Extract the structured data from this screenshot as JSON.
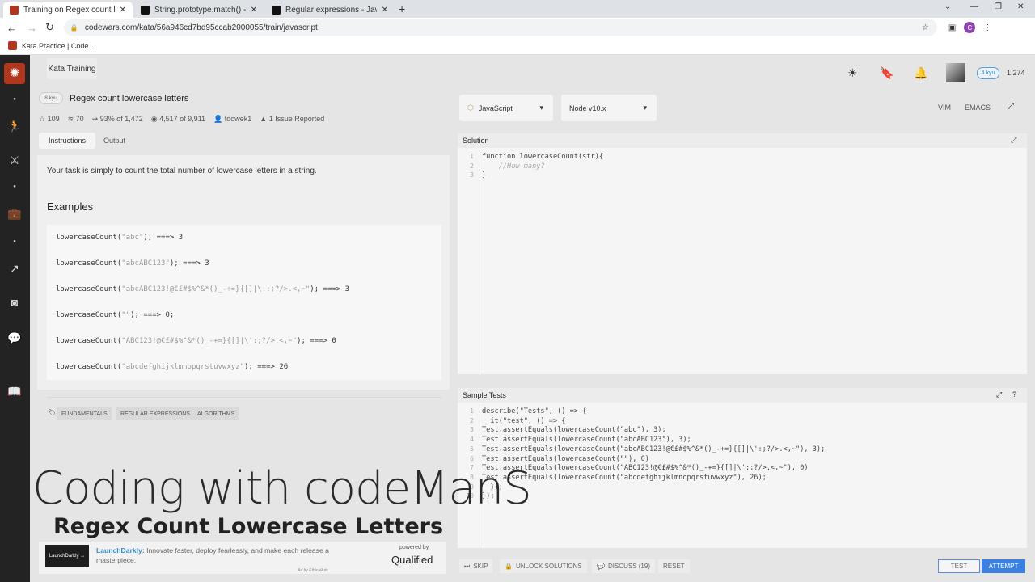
{
  "browser": {
    "tabs": [
      {
        "title": "Training on Regex count lowercase",
        "active": true
      },
      {
        "title": "String.prototype.match() - JavaSc",
        "active": false
      },
      {
        "title": "Regular expressions - JavaScript |",
        "active": false
      }
    ],
    "url": "codewars.com/kata/56a946cd7bd95ccab2000055/train/javascript",
    "bookmark": "Kata Practice | Code...",
    "profile_initial": "C"
  },
  "header": {
    "section": "Kata Training",
    "rank": "4 kyu",
    "honor": "1,274"
  },
  "kata": {
    "kyu": "8 kyu",
    "title": "Regex count lowercase letters",
    "stars": "109",
    "collections": "70",
    "satisfaction": "93% of 1,472",
    "completed": "4,517",
    "completed_of": "of 9,911",
    "author": "tdowek1",
    "issues": "1 Issue Reported"
  },
  "tabs": {
    "instructions": "Instructions",
    "output": "Output"
  },
  "description": "Your task is simply to count the total number of lowercase letters in a string.",
  "examples_heading": "Examples",
  "examples": [
    {
      "fn": "lowercaseCount(",
      "arg": "\"abc\"",
      "rest": "); ===> 3"
    },
    {
      "fn": "lowercaseCount(",
      "arg": "\"abcABC123\"",
      "rest": "); ===> 3"
    },
    {
      "fn": "lowercaseCount(",
      "arg": "\"abcABC123!@€£#$%^&*()_-+=}{[]|\\':;?/>.<,~\"",
      "rest": "); ===> 3"
    },
    {
      "fn": "lowercaseCount(",
      "arg": "\"\"",
      "rest": "); ===> 0;"
    },
    {
      "fn": "lowercaseCount(",
      "arg": "\"ABC123!@€£#$%^&*()_-+=}{[]|\\':;?/>.<,~\"",
      "rest": "); ===> 0"
    },
    {
      "fn": "lowercaseCount(",
      "arg": "\"abcdefghijklmnopqrstuvwxyz\"",
      "rest": "); ===> 26"
    }
  ],
  "tags": [
    "FUNDAMENTALS",
    "REGULAR EXPRESSIONS",
    "ALGORITHMS"
  ],
  "overlay": {
    "title": "Coding with codeManS",
    "subtitle": "Regex Count Lowercase Letters"
  },
  "ad": {
    "logo": "LaunchDarkly →",
    "brand": "LaunchDarkly:",
    "text": "Innovate faster, deploy fearlessly, and make each release a masterpiece.",
    "credit": "Ad by EthicalAds",
    "powered": "powered by",
    "qualified": "Qualified"
  },
  "editor": {
    "language": "JavaScript",
    "runtime": "Node v10.x",
    "vim": "VIM",
    "emacs": "EMACS",
    "solution_label": "Solution",
    "solution_lines": [
      "function lowercaseCount(str){",
      "    //How many?",
      "}"
    ],
    "tests_label": "Sample Tests",
    "test_lines": [
      "describe(\"Tests\", () => {",
      "  it(\"test\", () => {",
      "Test.assertEquals(lowercaseCount(\"abc\"), 3);",
      "Test.assertEquals(lowercaseCount(\"abcABC123\"), 3);",
      "Test.assertEquals(lowercaseCount(\"abcABC123!@€£#$%^&*()_-+=}{[]|\\':;?/>.<,~\"), 3);",
      "Test.assertEquals(lowercaseCount(\"\"), 0)",
      "Test.assertEquals(lowercaseCount(\"ABC123!@€£#$%^&*()_-+=}{[]|\\':;?/>.<,~\"), 0)",
      "Test.assertEquals(lowercaseCount(\"abcdefghijklmnopqrstuvwxyz\"), 26);",
      "  });",
      "});"
    ]
  },
  "actions": {
    "skip": "SKIP",
    "unlock": "UNLOCK SOLUTIONS",
    "discuss": "DISCUSS (19)",
    "reset": "RESET",
    "test": "TEST",
    "attempt": "ATTEMPT"
  }
}
